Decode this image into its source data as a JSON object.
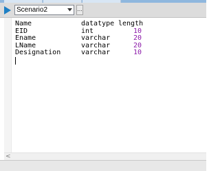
{
  "toolbar": {
    "run_icon": "play-icon",
    "scenario": "Scenario2",
    "more_label": "..."
  },
  "editor": {
    "header": {
      "name": "Name",
      "datatype": "datatype",
      "length": "length"
    },
    "rows": [
      {
        "name": "EID",
        "datatype": "int",
        "length": "10"
      },
      {
        "name": "Ename",
        "datatype": "varchar",
        "length": "20"
      },
      {
        "name": "LName",
        "datatype": "varchar",
        "length": "20"
      },
      {
        "name": "Designation",
        "datatype": "varchar",
        "length": "10"
      }
    ]
  },
  "colors": {
    "number": "#8a18a8",
    "play": "#1d7fc4"
  },
  "scrollbar": {
    "left_arrow_icon": "chevron-left-icon",
    "left_arrow": "<"
  }
}
